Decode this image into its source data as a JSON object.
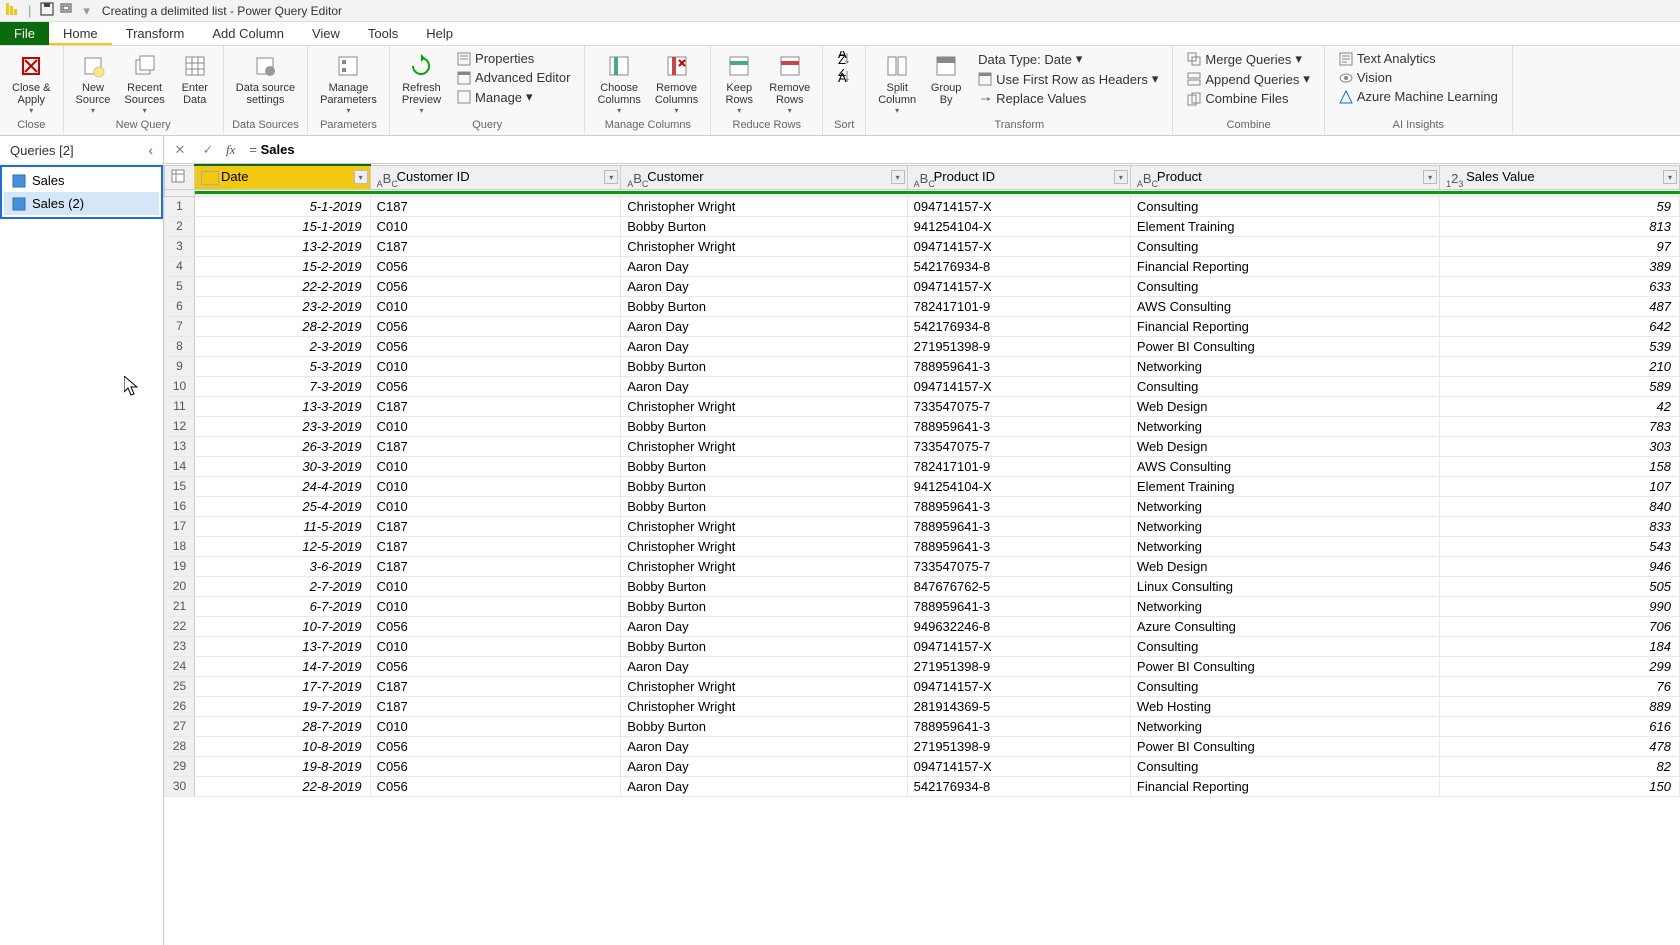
{
  "titlebar": {
    "title": "Creating a delimited list - Power Query Editor"
  },
  "menu": {
    "file": "File",
    "home": "Home",
    "transform": "Transform",
    "addcolumn": "Add Column",
    "view": "View",
    "tools": "Tools",
    "help": "Help"
  },
  "ribbon": {
    "close_apply": "Close &\nApply",
    "new_source": "New\nSource",
    "recent_sources": "Recent\nSources",
    "enter_data": "Enter\nData",
    "data_source": "Data source\nsettings",
    "manage_params": "Manage\nParameters",
    "refresh_preview": "Refresh\nPreview",
    "properties": "Properties",
    "advanced_editor": "Advanced Editor",
    "manage": "Manage",
    "choose_cols": "Choose\nColumns",
    "remove_cols": "Remove\nColumns",
    "keep_rows": "Keep\nRows",
    "remove_rows": "Remove\nRows",
    "split_col": "Split\nColumn",
    "group_by": "Group\nBy",
    "data_type": "Data Type: Date",
    "first_row_headers": "Use First Row as Headers",
    "replace_values": "Replace Values",
    "merge_queries": "Merge Queries",
    "append_queries": "Append Queries",
    "combine_files": "Combine Files",
    "text_analytics": "Text Analytics",
    "vision": "Vision",
    "azure_ml": "Azure Machine Learning",
    "g_close": "Close",
    "g_newquery": "New Query",
    "g_datasources": "Data Sources",
    "g_parameters": "Parameters",
    "g_query": "Query",
    "g_managecols": "Manage Columns",
    "g_reducerows": "Reduce Rows",
    "g_sort": "Sort",
    "g_transform": "Transform",
    "g_combine": "Combine",
    "g_ai": "AI Insights"
  },
  "queries": {
    "header": "Queries [2]",
    "items": [
      "Sales",
      "Sales (2)"
    ]
  },
  "formula": {
    "value": "Sales"
  },
  "columns": [
    "Date",
    "Customer ID",
    "Customer",
    "Product ID",
    "Product",
    "Sales Value"
  ],
  "rows": [
    {
      "n": 1,
      "date": "5-1-2019",
      "cid": "C187",
      "cust": "Christopher Wright",
      "pid": "094714157-X",
      "prod": "Consulting",
      "val": 59
    },
    {
      "n": 2,
      "date": "15-1-2019",
      "cid": "C010",
      "cust": "Bobby Burton",
      "pid": "941254104-X",
      "prod": "Element Training",
      "val": 813
    },
    {
      "n": 3,
      "date": "13-2-2019",
      "cid": "C187",
      "cust": "Christopher Wright",
      "pid": "094714157-X",
      "prod": "Consulting",
      "val": 97
    },
    {
      "n": 4,
      "date": "15-2-2019",
      "cid": "C056",
      "cust": "Aaron Day",
      "pid": "542176934-8",
      "prod": "Financial Reporting",
      "val": 389
    },
    {
      "n": 5,
      "date": "22-2-2019",
      "cid": "C056",
      "cust": "Aaron Day",
      "pid": "094714157-X",
      "prod": "Consulting",
      "val": 633
    },
    {
      "n": 6,
      "date": "23-2-2019",
      "cid": "C010",
      "cust": "Bobby Burton",
      "pid": "782417101-9",
      "prod": "AWS Consulting",
      "val": 487
    },
    {
      "n": 7,
      "date": "28-2-2019",
      "cid": "C056",
      "cust": "Aaron Day",
      "pid": "542176934-8",
      "prod": "Financial Reporting",
      "val": 642
    },
    {
      "n": 8,
      "date": "2-3-2019",
      "cid": "C056",
      "cust": "Aaron Day",
      "pid": "271951398-9",
      "prod": "Power BI Consulting",
      "val": 539
    },
    {
      "n": 9,
      "date": "5-3-2019",
      "cid": "C010",
      "cust": "Bobby Burton",
      "pid": "788959641-3",
      "prod": "Networking",
      "val": 210
    },
    {
      "n": 10,
      "date": "7-3-2019",
      "cid": "C056",
      "cust": "Aaron Day",
      "pid": "094714157-X",
      "prod": "Consulting",
      "val": 589
    },
    {
      "n": 11,
      "date": "13-3-2019",
      "cid": "C187",
      "cust": "Christopher Wright",
      "pid": "733547075-7",
      "prod": "Web Design",
      "val": 42
    },
    {
      "n": 12,
      "date": "23-3-2019",
      "cid": "C010",
      "cust": "Bobby Burton",
      "pid": "788959641-3",
      "prod": "Networking",
      "val": 783
    },
    {
      "n": 13,
      "date": "26-3-2019",
      "cid": "C187",
      "cust": "Christopher Wright",
      "pid": "733547075-7",
      "prod": "Web Design",
      "val": 303
    },
    {
      "n": 14,
      "date": "30-3-2019",
      "cid": "C010",
      "cust": "Bobby Burton",
      "pid": "782417101-9",
      "prod": "AWS Consulting",
      "val": 158
    },
    {
      "n": 15,
      "date": "24-4-2019",
      "cid": "C010",
      "cust": "Bobby Burton",
      "pid": "941254104-X",
      "prod": "Element Training",
      "val": 107
    },
    {
      "n": 16,
      "date": "25-4-2019",
      "cid": "C010",
      "cust": "Bobby Burton",
      "pid": "788959641-3",
      "prod": "Networking",
      "val": 840
    },
    {
      "n": 17,
      "date": "11-5-2019",
      "cid": "C187",
      "cust": "Christopher Wright",
      "pid": "788959641-3",
      "prod": "Networking",
      "val": 833
    },
    {
      "n": 18,
      "date": "12-5-2019",
      "cid": "C187",
      "cust": "Christopher Wright",
      "pid": "788959641-3",
      "prod": "Networking",
      "val": 543
    },
    {
      "n": 19,
      "date": "3-6-2019",
      "cid": "C187",
      "cust": "Christopher Wright",
      "pid": "733547075-7",
      "prod": "Web Design",
      "val": 946
    },
    {
      "n": 20,
      "date": "2-7-2019",
      "cid": "C010",
      "cust": "Bobby Burton",
      "pid": "847676762-5",
      "prod": "Linux Consulting",
      "val": 505
    },
    {
      "n": 21,
      "date": "6-7-2019",
      "cid": "C010",
      "cust": "Bobby Burton",
      "pid": "788959641-3",
      "prod": "Networking",
      "val": 990
    },
    {
      "n": 22,
      "date": "10-7-2019",
      "cid": "C056",
      "cust": "Aaron Day",
      "pid": "949632246-8",
      "prod": "Azure Consulting",
      "val": 706
    },
    {
      "n": 23,
      "date": "13-7-2019",
      "cid": "C010",
      "cust": "Bobby Burton",
      "pid": "094714157-X",
      "prod": "Consulting",
      "val": 184
    },
    {
      "n": 24,
      "date": "14-7-2019",
      "cid": "C056",
      "cust": "Aaron Day",
      "pid": "271951398-9",
      "prod": "Power BI Consulting",
      "val": 299
    },
    {
      "n": 25,
      "date": "17-7-2019",
      "cid": "C187",
      "cust": "Christopher Wright",
      "pid": "094714157-X",
      "prod": "Consulting",
      "val": 76
    },
    {
      "n": 26,
      "date": "19-7-2019",
      "cid": "C187",
      "cust": "Christopher Wright",
      "pid": "281914369-5",
      "prod": "Web Hosting",
      "val": 889
    },
    {
      "n": 27,
      "date": "28-7-2019",
      "cid": "C010",
      "cust": "Bobby Burton",
      "pid": "788959641-3",
      "prod": "Networking",
      "val": 616
    },
    {
      "n": 28,
      "date": "10-8-2019",
      "cid": "C056",
      "cust": "Aaron Day",
      "pid": "271951398-9",
      "prod": "Power BI Consulting",
      "val": 478
    },
    {
      "n": 29,
      "date": "19-8-2019",
      "cid": "C056",
      "cust": "Aaron Day",
      "pid": "094714157-X",
      "prod": "Consulting",
      "val": 82
    },
    {
      "n": 30,
      "date": "22-8-2019",
      "cid": "C056",
      "cust": "Aaron Day",
      "pid": "542176934-8",
      "prod": "Financial Reporting",
      "val": 150
    }
  ]
}
